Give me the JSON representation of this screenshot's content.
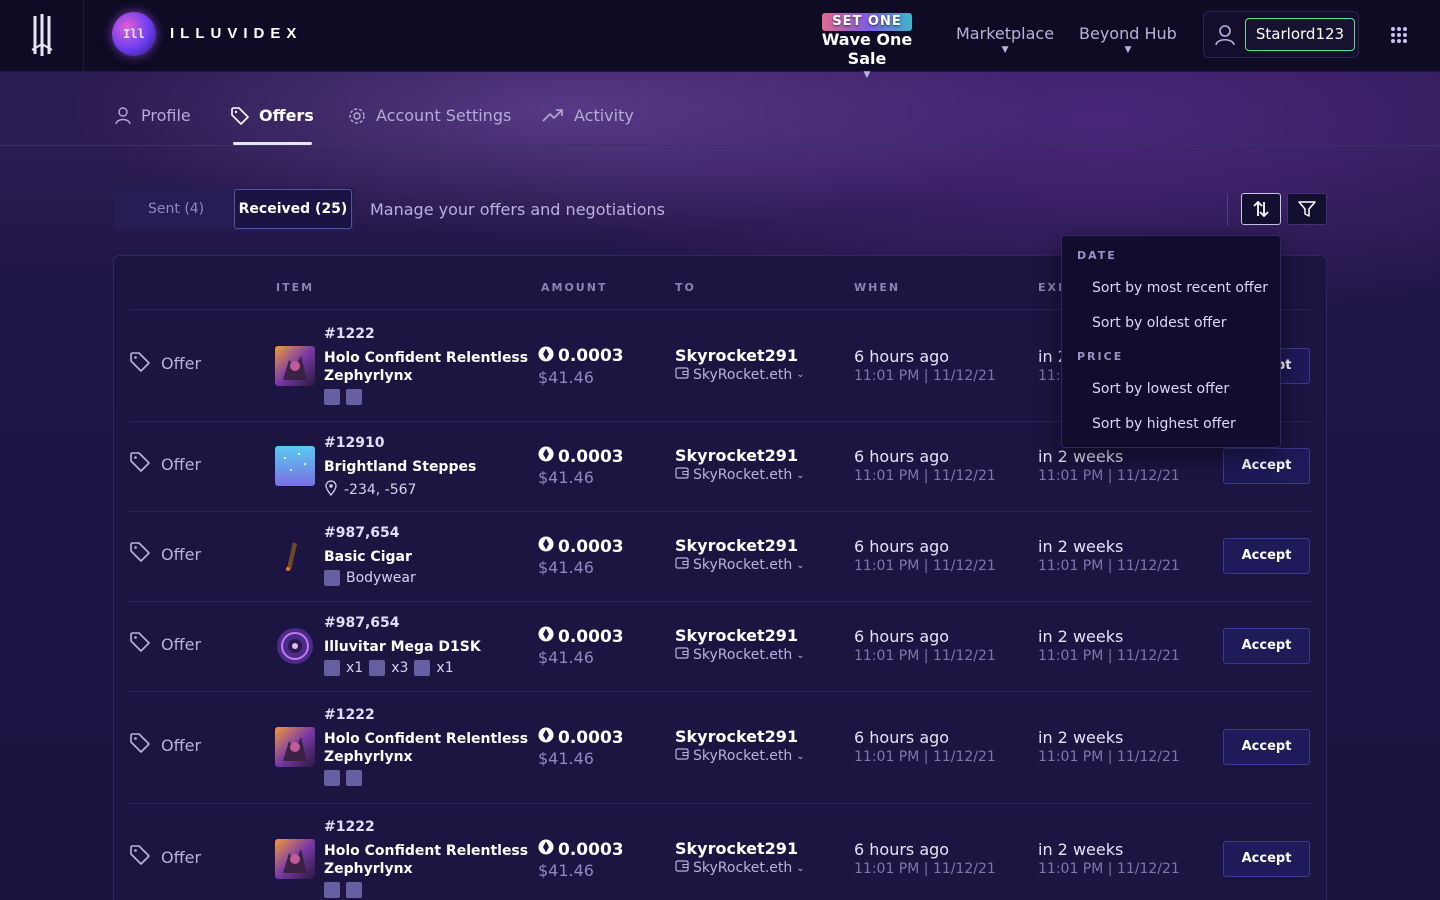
{
  "header": {
    "brand_name": "ILLUVIDEX",
    "brand_logo_text": "Ill",
    "nav": {
      "sale_badge": "SET ONE",
      "sale_label": "Wave One Sale",
      "marketplace": "Marketplace",
      "beyond_hub": "Beyond Hub"
    },
    "user": {
      "username": "Starlord123"
    }
  },
  "tabs": [
    {
      "label": "Profile",
      "icon": "user-icon"
    },
    {
      "label": "Offers",
      "icon": "tag-icon",
      "active": true
    },
    {
      "label": "Account Settings",
      "icon": "gear-icon"
    },
    {
      "label": "Activity",
      "icon": "trend-icon"
    }
  ],
  "toolbar": {
    "sent_label": "Sent (4)",
    "received_label": "Received (25)",
    "description": "Manage your offers and negotiations"
  },
  "table": {
    "columns": [
      "ITEM",
      "AMOUNT",
      "TO",
      "WHEN",
      "EXPIRES"
    ],
    "rows": [
      {
        "type": "Offer",
        "item_id": "#1222",
        "item_name": "Holo Confident Relentless Zephyrlynx",
        "meta": "",
        "amount": "0.0003",
        "usd": "$41.46",
        "to_name": "Skyrocket291",
        "to_wallet": "SkyRocket.eth",
        "when": "6 hours ago",
        "when_time": "11:01 PM | 11/12/21",
        "expires": "in 2 weeks",
        "expires_time": "11:01 PM | 11/12/21",
        "action": "Accept",
        "thumb": "creature"
      },
      {
        "type": "Offer",
        "item_id": "#12910",
        "item_name": "Brightland Steppes",
        "meta": "-234, -567",
        "amount": "0.0003",
        "usd": "$41.46",
        "to_name": "Skyrocket291",
        "to_wallet": "SkyRocket.eth",
        "when": "6 hours ago",
        "when_time": "11:01 PM | 11/12/21",
        "expires": "in 2 weeks",
        "expires_time": "11:01 PM | 11/12/21",
        "action": "Accept",
        "thumb": "land"
      },
      {
        "type": "Offer",
        "item_id": "#987,654",
        "item_name": "Basic Cigar",
        "meta": "Bodywear",
        "amount": "0.0003",
        "usd": "$41.46",
        "to_name": "Skyrocket291",
        "to_wallet": "SkyRocket.eth",
        "when": "6 hours ago",
        "when_time": "11:01 PM | 11/12/21",
        "expires": "in 2 weeks",
        "expires_time": "11:01 PM | 11/12/21",
        "action": "Accept",
        "thumb": "cigar"
      },
      {
        "type": "Offer",
        "item_id": "#987,654",
        "item_name": "Illuvitar Mega D1SK",
        "meta_counts": [
          "x1",
          "x3",
          "x1"
        ],
        "amount": "0.0003",
        "usd": "$41.46",
        "to_name": "Skyrocket291",
        "to_wallet": "SkyRocket.eth",
        "when": "6 hours ago",
        "when_time": "11:01 PM | 11/12/21",
        "expires": "in 2 weeks",
        "expires_time": "11:01 PM | 11/12/21",
        "action": "Accept",
        "thumb": "disk"
      },
      {
        "type": "Offer",
        "item_id": "#1222",
        "item_name": "Holo Confident Relentless Zephyrlynx",
        "meta": "",
        "amount": "0.0003",
        "usd": "$41.46",
        "to_name": "Skyrocket291",
        "to_wallet": "SkyRocket.eth",
        "when": "6 hours ago",
        "when_time": "11:01 PM | 11/12/21",
        "expires": "in 2 weeks",
        "expires_time": "11:01 PM | 11/12/21",
        "action": "Accept",
        "thumb": "creature"
      },
      {
        "type": "Offer",
        "item_id": "#1222",
        "item_name": "Holo Confident Relentless Zephyrlynx",
        "meta": "",
        "amount": "0.0003",
        "usd": "$41.46",
        "to_name": "Skyrocket291",
        "to_wallet": "SkyRocket.eth",
        "when": "6 hours ago",
        "when_time": "11:01 PM | 11/12/21",
        "expires": "in 2 weeks",
        "expires_time": "11:01 PM | 11/12/21",
        "action": "Accept",
        "thumb": "creature"
      }
    ]
  },
  "sort_menu": {
    "date_heading": "DATE",
    "date_options": [
      "Sort by most recent offer",
      "Sort by oldest offer"
    ],
    "price_heading": "PRICE",
    "price_options": [
      "Sort by lowest offer",
      "Sort by highest offer"
    ]
  },
  "colors": {
    "background": "#1a1340",
    "header": "#0f0b24",
    "accent_green": "#5fdc9a",
    "accept_button": "#1f1a58"
  }
}
